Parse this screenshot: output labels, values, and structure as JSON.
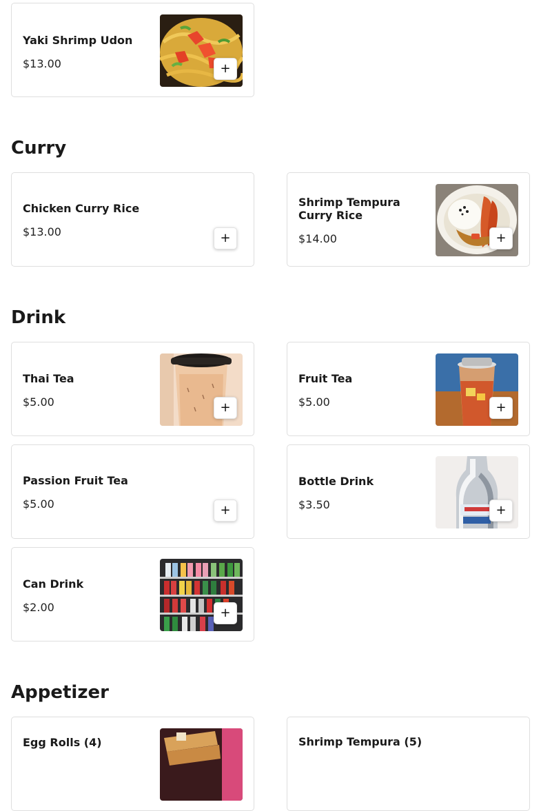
{
  "sections": [
    {
      "items": [
        {
          "name": "Yaki Shrimp Udon",
          "price": "$13.00",
          "add_symbol": "+",
          "image": "yaki-shrimp-udon-photo"
        }
      ]
    },
    {
      "title": "Curry",
      "items": [
        {
          "name": "Chicken Curry Rice",
          "price": "$13.00",
          "add_symbol": "+"
        },
        {
          "name": "Shrimp Tempura Curry Rice",
          "price": "$14.00",
          "add_symbol": "+",
          "image": "shrimp-tempura-curry-photo"
        }
      ]
    },
    {
      "title": "Drink",
      "items": [
        {
          "name": "Thai Tea",
          "price": "$5.00",
          "add_symbol": "+",
          "image": "thai-tea-photo"
        },
        {
          "name": "Fruit Tea",
          "price": "$5.00",
          "add_symbol": "+",
          "image": "fruit-tea-photo"
        },
        {
          "name": "Passion Fruit Tea",
          "price": "$5.00",
          "add_symbol": "+"
        },
        {
          "name": "Bottle Drink",
          "price": "$3.50",
          "add_symbol": "+",
          "image": "bottle-drink-photo"
        },
        {
          "name": "Can Drink",
          "price": "$2.00",
          "add_symbol": "+",
          "image": "can-drink-photo"
        }
      ]
    },
    {
      "title": "Appetizer",
      "items": [
        {
          "name": "Egg Rolls (4)",
          "image": "egg-rolls-photo"
        },
        {
          "name": "Shrimp Tempura (5)"
        }
      ]
    }
  ]
}
